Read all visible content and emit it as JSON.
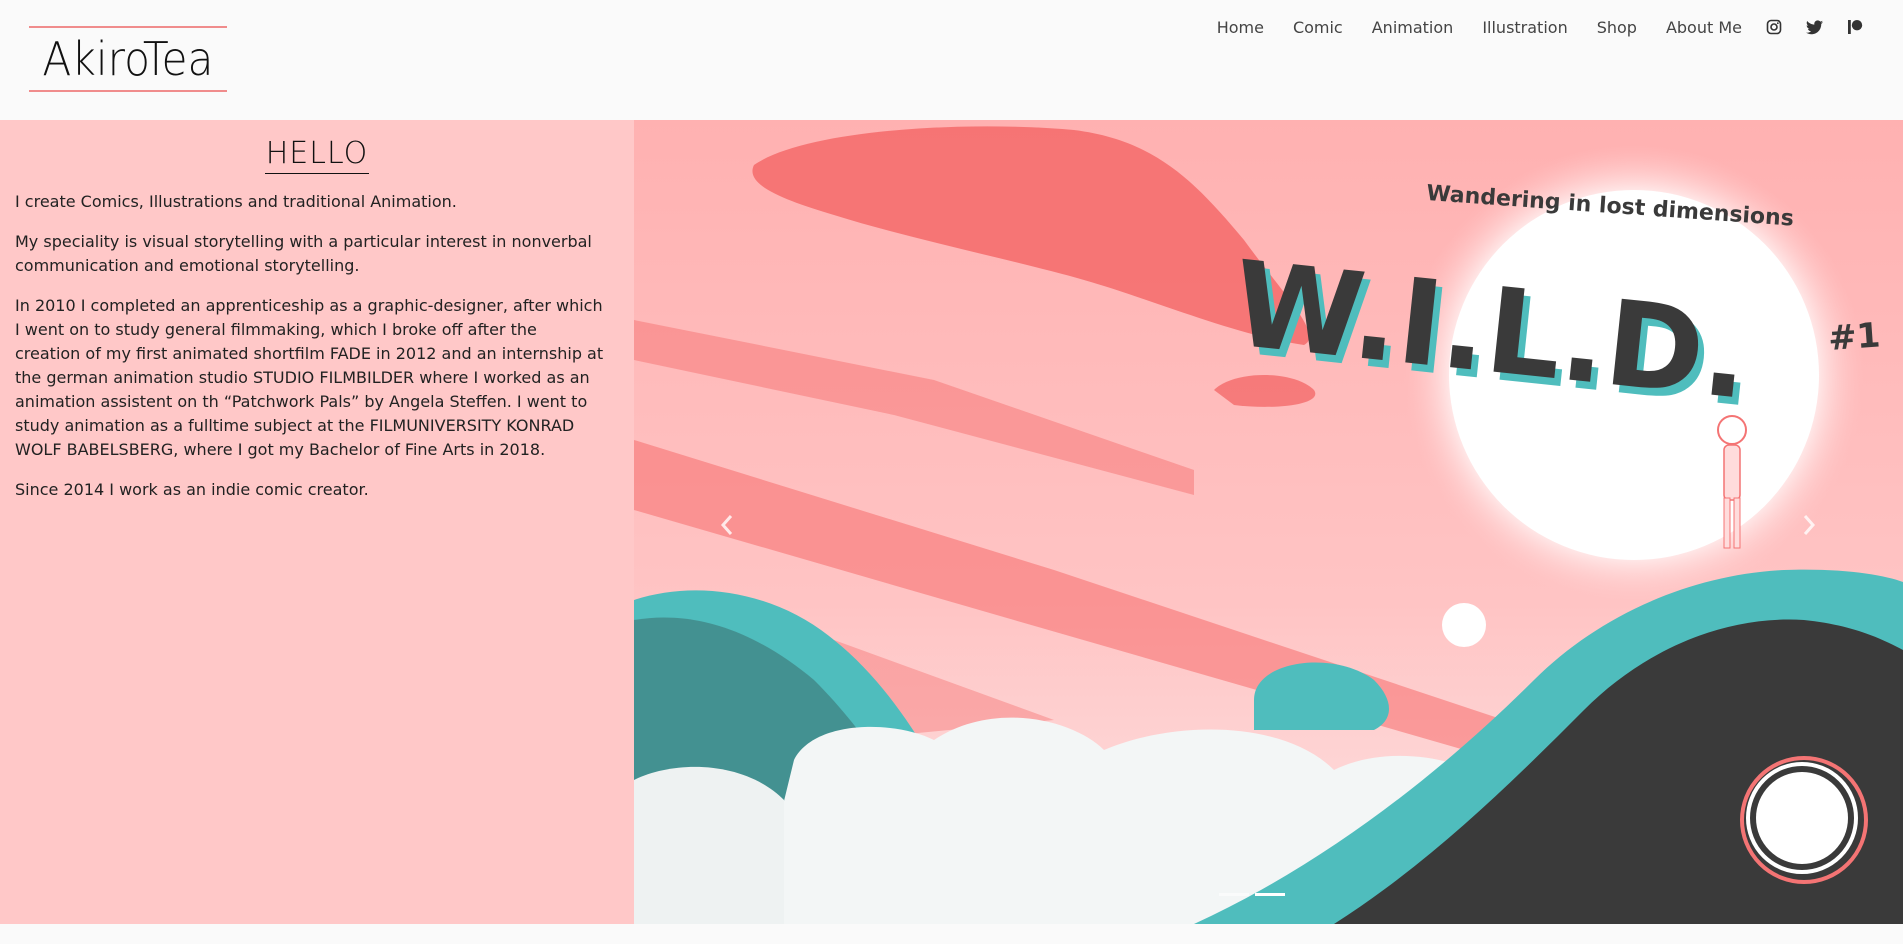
{
  "brand": {
    "logo_text": "AkiroTea",
    "accent_color": "#f08c8c"
  },
  "nav": {
    "items": [
      "Home",
      "Comic",
      "Animation",
      "Illustration",
      "Shop",
      "About Me"
    ],
    "social_icons": [
      "instagram-icon",
      "twitter-icon",
      "patreon-icon"
    ]
  },
  "about": {
    "heading": "HELLO",
    "paragraphs": [
      "I create Comics, Illustrations and traditional Animation.",
      "My speciality is visual storytelling with a particular interest in nonverbal communication and emotional storytelling.",
      "In 2010 I completed an apprenticeship as a graphic-designer, after which I went on to study general filmmaking, which I broke off after the creation of my first animated shortfilm FADE in 2012 and an internship at the german animation studio STUDIO FILMBILDER where I worked as an animation assistent on th “Patchwork Pals” by Angela Steffen. I went to study animation as a fulltime subject at the FILMUNIVERSITY KONRAD WOLF BABELSBERG, where I got my Bachelor of Fine Arts in 2018.",
      "Since 2014 I work as an indie comic creator."
    ],
    "panel_color": "#ffc8c8"
  },
  "slider": {
    "artwork": {
      "subtitle": "Wandering in lost dimensions",
      "title": "W.I.L.D.",
      "issue": "#1"
    },
    "prev_icon": "chevron-left-icon",
    "next_icon": "chevron-right-icon",
    "slide_count": 2,
    "active_index": 1,
    "colors": {
      "pink": "#f47474",
      "teal": "#4fbdbd",
      "dark": "#3a3a3a"
    }
  }
}
